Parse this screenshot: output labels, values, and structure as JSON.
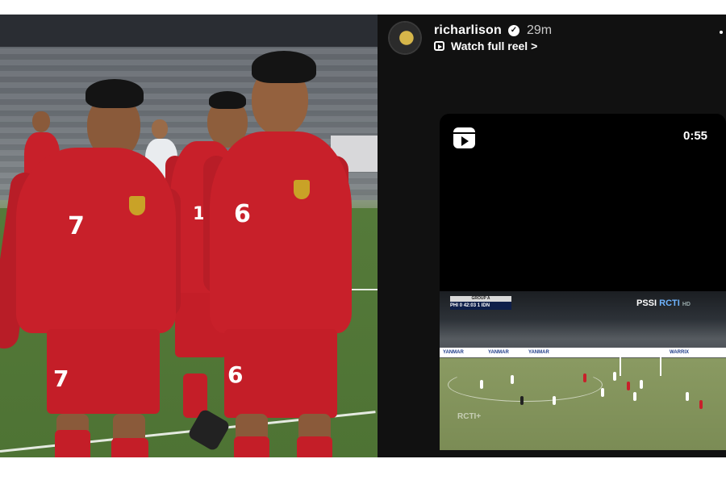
{
  "photo": {
    "players": [
      {
        "number": "7"
      },
      {
        "number": "17"
      },
      {
        "number": "6"
      }
    ]
  },
  "story": {
    "username": "richarlison",
    "verified": true,
    "time": "29m",
    "link_label": "Watch full reel",
    "link_chevron": ">",
    "menu_icon": "more-dots-icon"
  },
  "reel": {
    "duration": "0:55",
    "icon": "reels-icon",
    "scorebug": {
      "header": "GROUP A",
      "home": "PHI",
      "clock": "42:03",
      "away": "IDN",
      "home_score": "0",
      "away_score": "1"
    },
    "broadcaster_left": "PSSI",
    "broadcaster_right": "RCTI",
    "broadcaster_sub": "HD",
    "watermark": "RCTI+",
    "ads": [
      "YANMAR",
      "YANMAR",
      "YANMAR",
      "WARRIX"
    ]
  },
  "colors": {
    "story_bg": "#111111",
    "kit_red": "#c8202a",
    "pitch_green": "#557a3a"
  }
}
